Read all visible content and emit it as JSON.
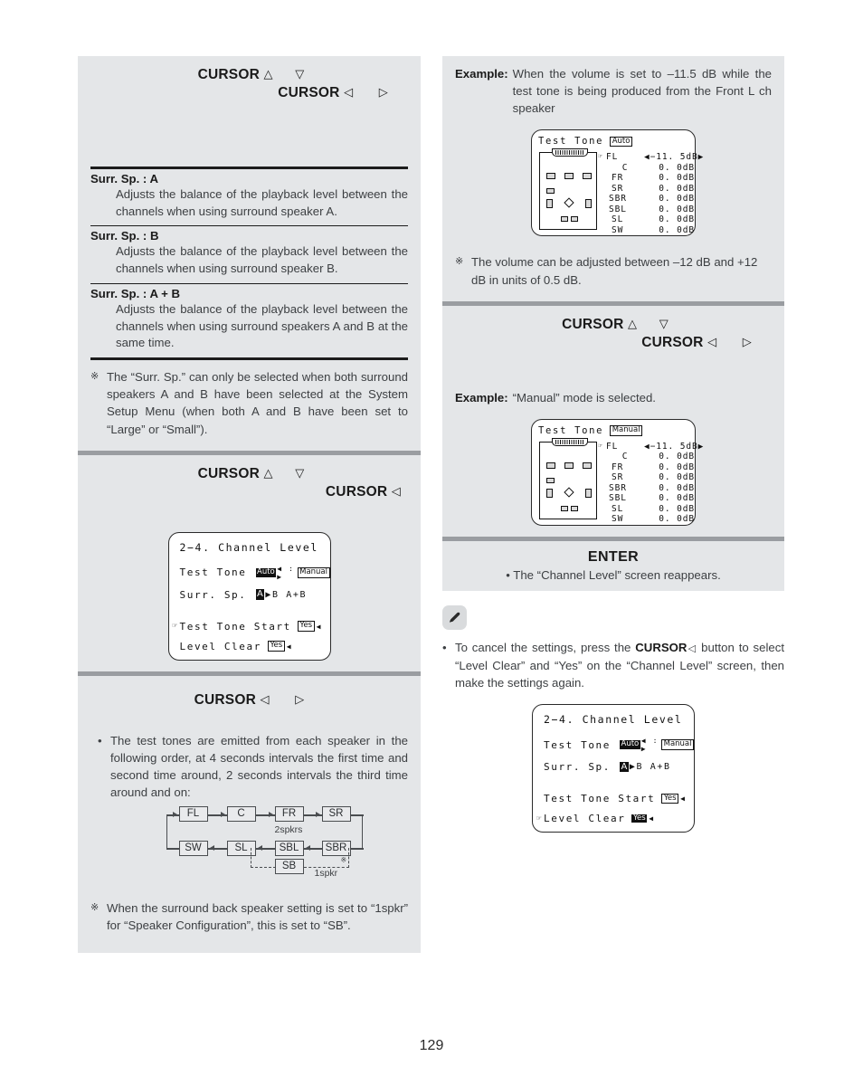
{
  "page": {
    "number": "129"
  },
  "left": {
    "section1": {
      "cursor_up": {
        "label": "CURSOR",
        "up": "△",
        "down": "▽"
      },
      "cursor_lr": {
        "label": "CURSOR",
        "left": "◁",
        "right": "▷"
      },
      "defs": [
        {
          "term": "Surr. Sp. : A",
          "desc": "Adjusts the balance of the playback level between the channels when using surround speaker A."
        },
        {
          "term": "Surr. Sp. : B",
          "desc": "Adjusts the balance of the playback level between the channels when using surround speaker B."
        },
        {
          "term": "Surr. Sp. : A + B",
          "desc": "Adjusts the balance of the playback level between the channels when using surround speakers A and B at the same time."
        }
      ],
      "note": {
        "mark": "※",
        "text": "The “Surr. Sp.” can only be selected when both surround speakers A and B have been selected at the System Setup Menu (when both A and B have been set to “Large” or “Small”)."
      }
    },
    "section2": {
      "cursor_up": {
        "label": "CURSOR",
        "up": "△",
        "down": "▽"
      },
      "cursor_left": {
        "label": "CURSOR",
        "left": "◁"
      },
      "osd": {
        "title": "2−4. Channel Level",
        "rows": [
          {
            "label": "Test Tone",
            "cursor": "",
            "chip1": "Auto",
            "chip1_style": "inv",
            "mid": "◀ : ▶",
            "chip2": "Manual",
            "chip2_style": "box"
          },
          {
            "label": "Surr. Sp.",
            "cursor": "",
            "chip1": "A",
            "chip1_style": "inv",
            "mid": "▶B  A+B",
            "chip2": "",
            "chip2_style": ""
          },
          {
            "label": "Test Tone Start",
            "cursor": "☞",
            "chip1": "Yes",
            "chip1_style": "box",
            "mid": "◀",
            "chip2": "",
            "chip2_style": ""
          },
          {
            "label": "Level Clear",
            "cursor": "",
            "chip1": "Yes",
            "chip1_style": "box",
            "mid": "◀",
            "chip2": "",
            "chip2_style": ""
          }
        ]
      }
    },
    "section3": {
      "cursor_lr": {
        "label": "CURSOR",
        "left": "◁",
        "right": "▷"
      },
      "bullet": "The test tones are emitted from each speaker in the following order, at 4 seconds intervals the first time and second time around, 2 seconds intervals the third time around and on:",
      "flow": {
        "row1": [
          "FL",
          "C",
          "FR",
          "SR"
        ],
        "row2": [
          "SW",
          "SL",
          "SBL",
          "SBR"
        ],
        "alt": "SB",
        "label_2spkrs": "2spkrs",
        "label_1spkr": "1spkr",
        "label_mark": "※"
      },
      "note": {
        "mark": "※",
        "text": "When the surround back speaker setting is set to “1spkr” for “Speaker Configuration”, this is set to “SB”."
      }
    }
  },
  "right": {
    "section1": {
      "example": {
        "label": "Example:",
        "text": "When the volume is set to –11.5 dB while the test tone is being produced from the Front L ch speaker"
      },
      "osd": {
        "title": "Test Tone",
        "mode": "Auto",
        "mode_style": "box",
        "channels": [
          {
            "name": "FL",
            "value": "◀−11. 5dB▶",
            "selected": true
          },
          {
            "name": "C",
            "value": "0. 0dB",
            "selected": false
          },
          {
            "name": "FR",
            "value": "0. 0dB",
            "selected": false
          },
          {
            "name": "SR",
            "value": "0. 0dB",
            "selected": false
          },
          {
            "name": "SBR",
            "value": "0. 0dB",
            "selected": false
          },
          {
            "name": "SBL",
            "value": "0. 0dB",
            "selected": false
          },
          {
            "name": "SL",
            "value": "0. 0dB",
            "selected": false
          },
          {
            "name": "SW",
            "value": "0. 0dB",
            "selected": false
          }
        ]
      },
      "note": {
        "mark": "※",
        "text": "The volume can be adjusted between –12 dB and +12 dB in units of 0.5 dB."
      }
    },
    "section2": {
      "cursor_up": {
        "label": "CURSOR",
        "up": "△",
        "down": "▽"
      },
      "cursor_lr": {
        "label": "CURSOR",
        "left": "◁",
        "right": "▷"
      },
      "example": {
        "label": "Example:",
        "text": "“Manual” mode is selected."
      },
      "osd": {
        "title": "Test Tone",
        "mode": "Manual",
        "mode_style": "box",
        "channels": [
          {
            "name": "FL",
            "value": "◀−11. 5dB▶",
            "selected": true
          },
          {
            "name": "C",
            "value": "0. 0dB",
            "selected": false
          },
          {
            "name": "FR",
            "value": "0. 0dB",
            "selected": false
          },
          {
            "name": "SR",
            "value": "0. 0dB",
            "selected": false
          },
          {
            "name": "SBR",
            "value": "0. 0dB",
            "selected": false
          },
          {
            "name": "SBL",
            "value": "0. 0dB",
            "selected": false
          },
          {
            "name": "SL",
            "value": "0. 0dB",
            "selected": false
          },
          {
            "name": "SW",
            "value": "0. 0dB",
            "selected": false
          }
        ]
      }
    },
    "section3": {
      "enter_label": "ENTER",
      "enter_text": "• The “Channel Level” screen reappears."
    },
    "memo": {
      "icon": "pencil-icon",
      "bullet_mark": "•",
      "text_a": "To cancel the settings, press the ",
      "cursor_bold": "CURSOR",
      "cursor_arrow": "◁",
      "text_b": " button to select “Level Clear” and “Yes” on the “Channel Level” screen, then make the settings again.",
      "osd": {
        "title": "2−4. Channel Level",
        "rows": [
          {
            "label": "Test Tone",
            "cursor": "",
            "chip1": "Auto",
            "chip1_style": "inv",
            "mid": "◀ : ▶",
            "chip2": "Manual",
            "chip2_style": "box"
          },
          {
            "label": "Surr. Sp.",
            "cursor": "",
            "chip1": "A",
            "chip1_style": "inv",
            "mid": "▶B  A+B",
            "chip2": "",
            "chip2_style": ""
          },
          {
            "label": "Test Tone Start",
            "cursor": "",
            "chip1": "Yes",
            "chip1_style": "box",
            "mid": "◀",
            "chip2": "",
            "chip2_style": ""
          },
          {
            "label": "Level Clear",
            "cursor": "☞",
            "chip1": "Yes",
            "chip1_style": "inv",
            "mid": "◀",
            "chip2": "",
            "chip2_style": ""
          }
        ]
      }
    }
  }
}
